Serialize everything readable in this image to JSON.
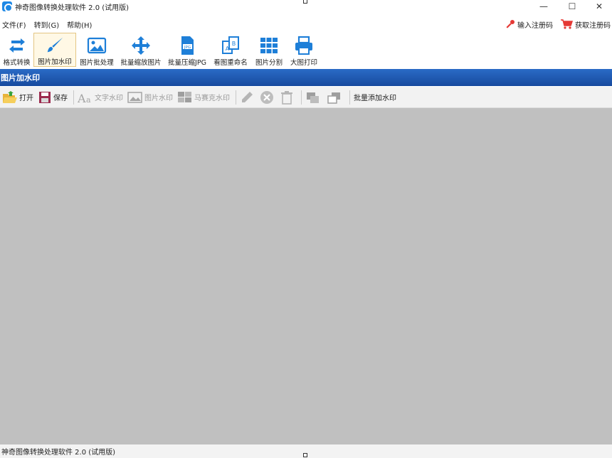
{
  "window": {
    "title": "神奇图像转换处理软件 2.0 (试用版)",
    "minimize_glyph": "—",
    "maximize_glyph": "☐",
    "close_glyph": "✕"
  },
  "menu": {
    "items": [
      {
        "label": "文件(F)"
      },
      {
        "label": "转到(G)"
      },
      {
        "label": "帮助(H)"
      }
    ],
    "register_label": "输入注册码",
    "buy_label": "获取注册码"
  },
  "toolbar": {
    "items": [
      {
        "label": "格式转换",
        "icon": "convert-icon"
      },
      {
        "label": "图片加水印",
        "icon": "brush-icon"
      },
      {
        "label": "图片批处理",
        "icon": "picture-icon"
      },
      {
        "label": "批量缩放图片",
        "icon": "move-arrows-icon"
      },
      {
        "label": "批量压缩JPG",
        "icon": "jpg-file-icon"
      },
      {
        "label": "看图重命名",
        "icon": "rename-icon"
      },
      {
        "label": "图片分割",
        "icon": "grid-split-icon"
      },
      {
        "label": "大图打印",
        "icon": "printer-icon"
      }
    ],
    "active_index": 1
  },
  "section": {
    "title": "图片加水印"
  },
  "subtoolbar": {
    "open_label": "打开",
    "save_label": "保存",
    "text_wm_label": "文字水印",
    "image_wm_label": "图片水印",
    "mosaic_wm_label": "马赛克水印",
    "batch_label": "批量添加水印"
  },
  "status": {
    "text": "神奇图像转换处理软件 2.0 (试用版)"
  },
  "colors": {
    "accent_blue": "#1e7fd8",
    "header_blue": "#1f5bb5",
    "workspace_gray": "#c0c0c0"
  }
}
